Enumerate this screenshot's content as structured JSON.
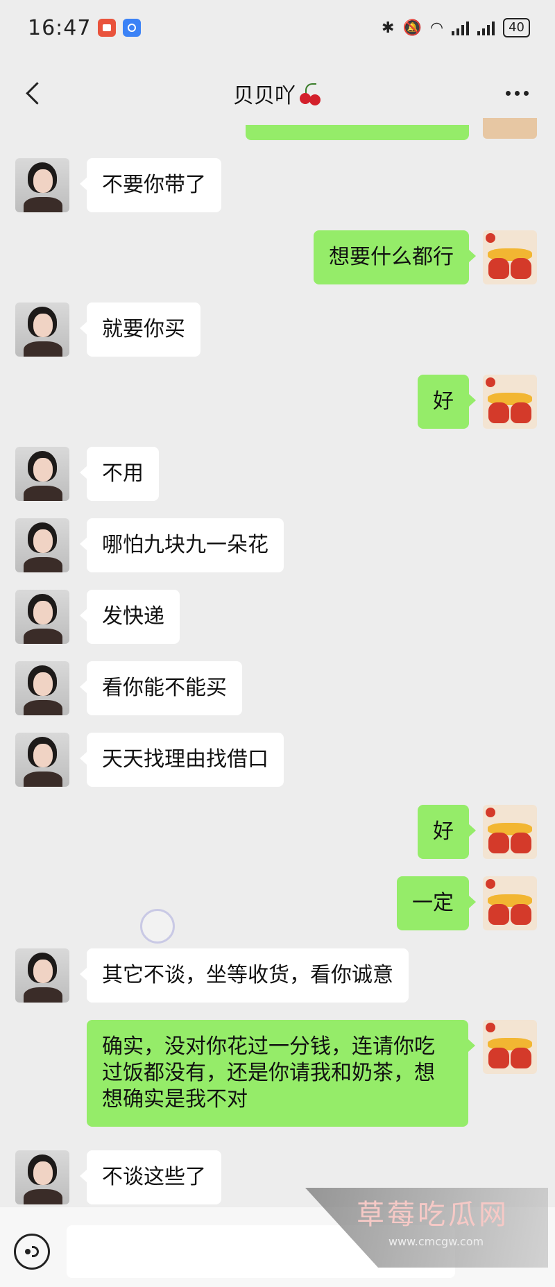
{
  "status_bar": {
    "time": "16:47",
    "battery": "40"
  },
  "header": {
    "title": "贝贝吖"
  },
  "messages": [
    {
      "side": "left",
      "text": "不要你带了"
    },
    {
      "side": "right",
      "text": "想要什么都行"
    },
    {
      "side": "left",
      "text": "就要你买"
    },
    {
      "side": "right",
      "text": "好"
    },
    {
      "side": "left",
      "text": "不用"
    },
    {
      "side": "left",
      "text": "哪怕九块九一朵花"
    },
    {
      "side": "left",
      "text": "发快递"
    },
    {
      "side": "left",
      "text": "看你能不能买"
    },
    {
      "side": "left",
      "text": "天天找理由找借口"
    },
    {
      "side": "right",
      "text": "好"
    },
    {
      "side": "right",
      "text": "一定"
    },
    {
      "side": "left",
      "text": "其它不谈，坐等收货，看你诚意"
    },
    {
      "side": "right",
      "text": "确实，没对你花过一分钱，连请你吃过饭都没有，还是你请我和奶茶，想想确实是我不对"
    },
    {
      "side": "left",
      "text": "不谈这些了"
    }
  ],
  "input": {
    "value": ""
  },
  "watermark": {
    "title": "草莓吃瓜网",
    "url": "www.cmcgw.com"
  },
  "colors": {
    "background": "#ededed",
    "bubble_self": "#95ec69",
    "bubble_other": "#ffffff"
  }
}
